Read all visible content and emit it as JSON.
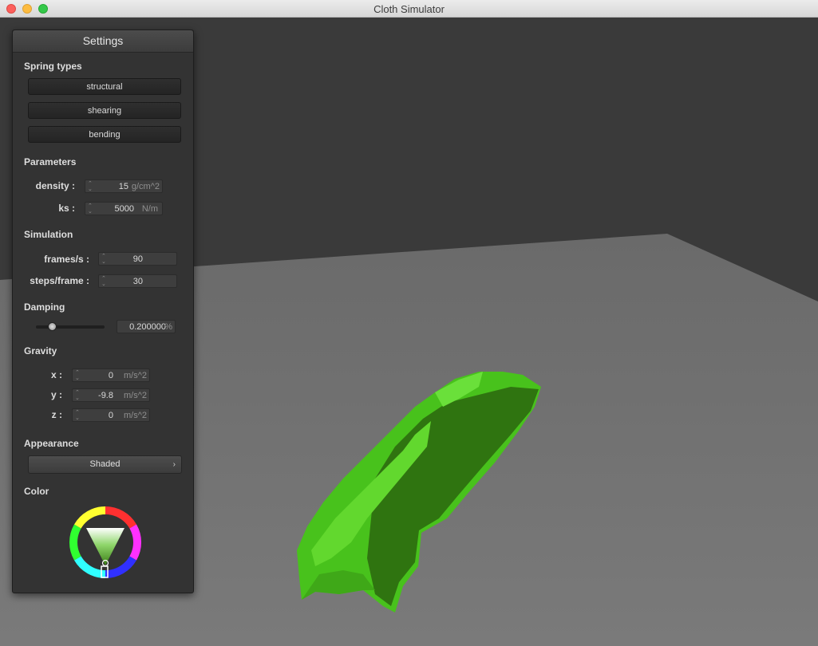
{
  "window": {
    "title": "Cloth Simulator"
  },
  "panel": {
    "title": "Settings",
    "spring_types": {
      "heading": "Spring types",
      "buttons": [
        "structural",
        "shearing",
        "bending"
      ]
    },
    "parameters": {
      "heading": "Parameters",
      "density": {
        "label": "density :",
        "value": "15",
        "unit": "g/cm^2"
      },
      "ks": {
        "label": "ks :",
        "value": "5000",
        "unit": "N/m"
      }
    },
    "simulation": {
      "heading": "Simulation",
      "fps": {
        "label": "frames/s :",
        "value": "90"
      },
      "steps": {
        "label": "steps/frame :",
        "value": "30"
      }
    },
    "damping": {
      "heading": "Damping",
      "value": "0.200000",
      "unit": "%",
      "slider_fraction": 0.2
    },
    "gravity": {
      "heading": "Gravity",
      "x": {
        "label": "x :",
        "value": "0",
        "unit": "m/s^2"
      },
      "y": {
        "label": "y :",
        "value": "-9.8",
        "unit": "m/s^2"
      },
      "z": {
        "label": "z :",
        "value": "0",
        "unit": "m/s^2"
      }
    },
    "appearance": {
      "heading": "Appearance",
      "selected": "Shaded"
    },
    "color": {
      "heading": "Color",
      "selected_hex": "#6fbf3a"
    }
  },
  "scene": {
    "background": "#3a3a3a",
    "plane": "#6f6f6f",
    "cloth_light": "#4fcf1c",
    "cloth_dark": "#2a6b0a"
  }
}
